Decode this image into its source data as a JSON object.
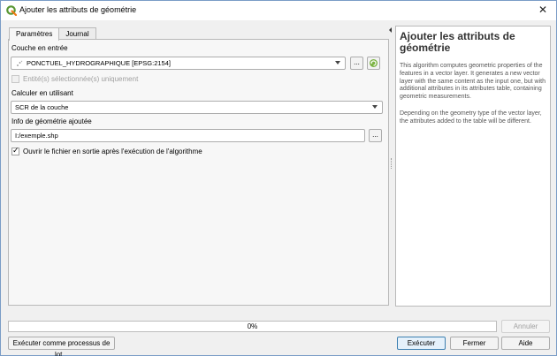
{
  "window": {
    "title": "Ajouter les attributs de géométrie",
    "close_icon": "close-icon"
  },
  "tabs": [
    {
      "label": "Paramètres",
      "active": true
    },
    {
      "label": "Journal",
      "active": false
    }
  ],
  "params": {
    "input_layer": {
      "label": "Couche en entrée",
      "value": "PONCTUEL_HYDROGRAPHIQUE [EPSG:2154]",
      "icon": "point-layer-icon"
    },
    "selected_only": {
      "label": "Entité(s) sélectionnée(s) uniquement",
      "checked": false,
      "enabled": false
    },
    "calc_using": {
      "label": "Calculer en utilisant",
      "value": "SCR de la couche"
    },
    "output": {
      "label": "Info de géométrie ajoutée",
      "value": "I:/exemple.shp"
    },
    "open_output": {
      "label": "Ouvrir le fichier en sortie après l'exécution de l'algorithme",
      "checked": true
    },
    "browse_label": "...",
    "browse2_label": "..."
  },
  "help": {
    "title": "Ajouter les attributs de géométrie",
    "paragraph1": "This algorithm computes geometric properties of the features in a vector layer. It generates a new vector layer with the same content as the input one, but with additional attributes in its attributes table, containing geometric measurements.",
    "paragraph2": "Depending on the geometry type of the vector layer, the attributes added to the table will be different."
  },
  "progress": {
    "text": "0%",
    "value": 0
  },
  "buttons": {
    "cancel": "Annuler",
    "batch": "Exécuter comme processus de lot...",
    "run": "Exécuter",
    "close": "Fermer",
    "help": "Aide"
  },
  "colors": {
    "qgis_green": "#589632",
    "qgis_yellow": "#ee7913",
    "window_border": "#7a9cc6"
  }
}
